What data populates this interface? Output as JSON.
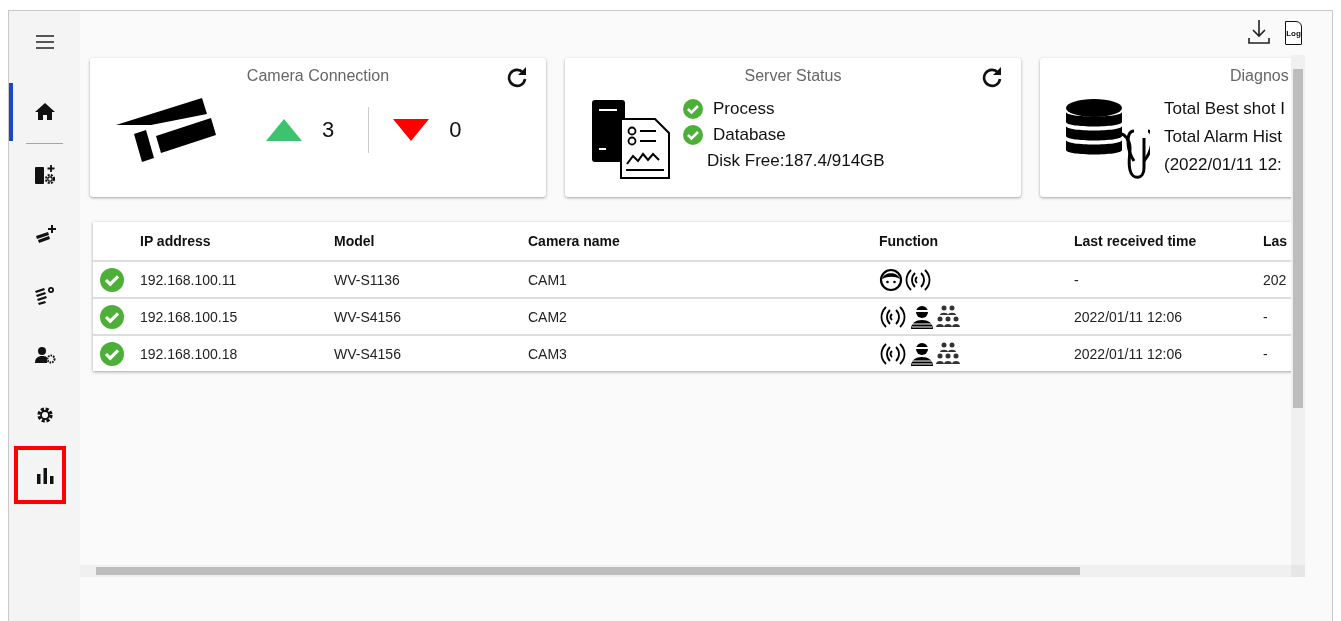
{
  "sidebar": {
    "items": [
      {
        "kind": "menu",
        "selected": false,
        "highlighted": false
      },
      {
        "kind": "home",
        "selected": true,
        "highlighted": false
      },
      {
        "kind": "device-add",
        "selected": false,
        "highlighted": false
      },
      {
        "kind": "camera-add",
        "selected": false,
        "highlighted": false
      },
      {
        "kind": "camera-settings",
        "selected": false,
        "highlighted": false
      },
      {
        "kind": "user-settings",
        "selected": false,
        "highlighted": false
      },
      {
        "kind": "settings",
        "selected": false,
        "highlighted": false
      },
      {
        "kind": "statistics",
        "selected": false,
        "highlighted": true
      }
    ]
  },
  "top_bar": {
    "log_label": "Log"
  },
  "cards": [
    {
      "kind": "camera",
      "title": "Camera Connection",
      "up_count": "3",
      "down_count": "0"
    },
    {
      "kind": "server",
      "title": "Server Status",
      "items": [
        {
          "label": "Process",
          "ok": true
        },
        {
          "label": "Database",
          "ok": true
        }
      ],
      "disk": "Disk Free:187.4/914GB"
    },
    {
      "kind": "diagnosis",
      "title": "Diagnos",
      "lines": [
        "Total Best shot I",
        "Total Alarm Hist",
        "(2022/01/11 12:"
      ]
    }
  ],
  "table": {
    "columns": [
      "IP address",
      "Model",
      "Camera name",
      "Function",
      "Last received time",
      "Las"
    ],
    "rows": [
      {
        "connected": true,
        "ip": "192.168.100.11",
        "model": "WV-S1136",
        "name": "CAM1",
        "functions": [
          {
            "kind": "face"
          },
          {
            "kind": "signal"
          }
        ],
        "last_received": "-",
        "column_6": "202"
      },
      {
        "connected": true,
        "ip": "192.168.100.15",
        "model": "WV-S4156",
        "name": "CAM2",
        "functions": [
          {
            "kind": "signal"
          },
          {
            "kind": "masked-person"
          },
          {
            "kind": "crowd"
          }
        ],
        "last_received": "2022/01/11 12:06",
        "column_6": "-"
      },
      {
        "connected": true,
        "ip": "192.168.100.18",
        "model": "WV-S4156",
        "name": "CAM3",
        "functions": [
          {
            "kind": "signal"
          },
          {
            "kind": "masked-person"
          },
          {
            "kind": "crowd"
          }
        ],
        "last_received": "2022/01/11 12:06",
        "column_6": "-"
      }
    ]
  }
}
